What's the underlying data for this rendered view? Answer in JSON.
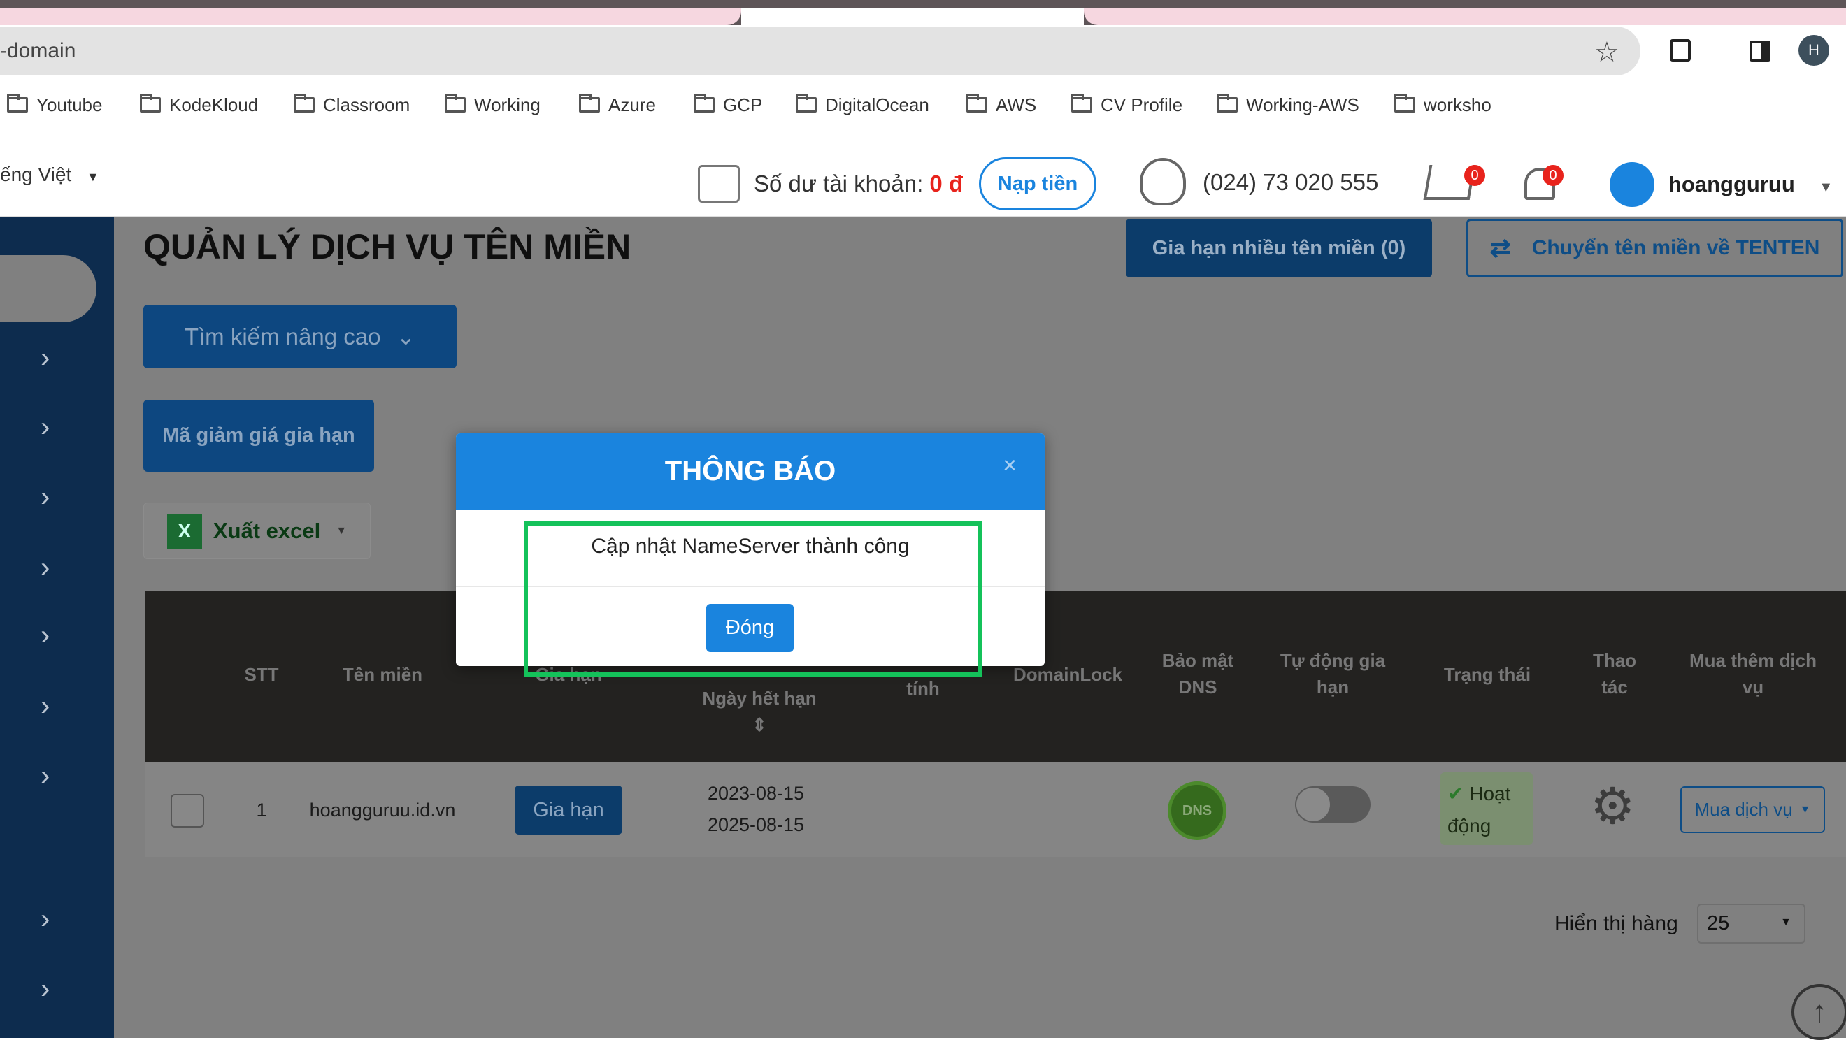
{
  "browser": {
    "address": "-domain",
    "profile_initial": "H",
    "bookmarks": [
      "Youtube",
      "KodeKloud",
      "Classroom",
      "Working",
      "Azure",
      "GCP",
      "DigitalOcean",
      "AWS",
      "CV Profile",
      "Working-AWS",
      "worksho"
    ]
  },
  "header": {
    "language": "ếng Việt",
    "balance_label": "Số dư tài khoản:",
    "balance_value": "0 đ",
    "topup": "Nạp tiền",
    "phone": "(024) 73 020 555",
    "cart_count": "0",
    "notif_count": "0",
    "username": "hoangguruu"
  },
  "main": {
    "title": "QUẢN LÝ DỊCH VỤ TÊN MIỀN",
    "renew_many": "Gia hạn nhiều tên miền (0)",
    "transfer": "Chuyển tên miền về TENTEN",
    "advanced_search": "Tìm kiếm nâng cao",
    "coupon": "Mã giảm giá gia hạn",
    "export": "Xuất excel",
    "columns": [
      "STT",
      "Tên miền",
      "Gia hạn",
      "Ngày hết hạn",
      "tính",
      "DomainLock",
      "Bảo mật DNS",
      "Tự động gia hạn",
      "Trạng thái",
      "Thao tác",
      "Mua thêm dịch vụ"
    ],
    "rows": [
      {
        "stt": "1",
        "domain": "hoangguruu.id.vn",
        "renew": "Gia hạn",
        "start": "2023-08-15",
        "end": "2025-08-15",
        "dns": "DNS",
        "status": "Hoạt động",
        "buy": "Mua dịch vụ"
      }
    ],
    "rows_label": "Hiển thị hàng",
    "rows_value": "25"
  },
  "modal": {
    "title": "THÔNG BÁO",
    "close": "×",
    "message": "Cập nhật NameServer thành công",
    "ok": "Đóng"
  },
  "colors": {
    "primary": "#1a84de",
    "highlight": "#14c25a"
  }
}
